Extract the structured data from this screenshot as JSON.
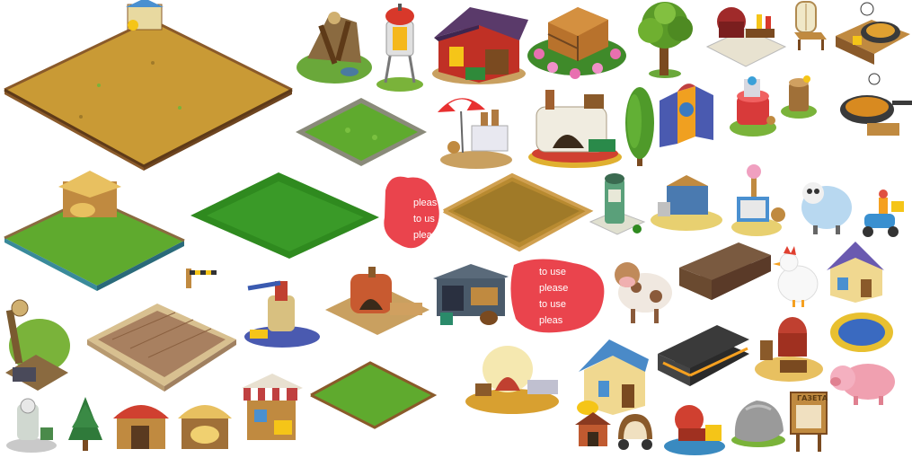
{
  "sheet": {
    "watermark_a": {
      "line1": "pleas",
      "line2": "to us",
      "line3": "pleas"
    },
    "watermark_b": {
      "line1": "to use",
      "line2": "please",
      "line3": "to use",
      "line4": "pleas"
    },
    "notice_board_text": "ГАЗЕТА"
  },
  "colors": {
    "soil": "#c99a35",
    "grass": "#5faa2e",
    "dark_grass": "#2f8a1f",
    "fence": "#8a5a2a",
    "watermark_red": "#e8303a"
  },
  "assets": [
    "plowed-field-fenced-large",
    "mine-shaft-ruins",
    "water-tower",
    "barn-red-purple-roof",
    "wooden-crate-flowers",
    "oak-tree",
    "bbq-grill",
    "wooden-chair",
    "cooking-stove-chef",
    "grass-plot-stone-border",
    "market-umbrella-stall",
    "stone-oven",
    "cypress-tree",
    "folding-screen",
    "red-decoration-tower",
    "tree-stump",
    "frying-pan-stall",
    "chicken-coop-straw-roof",
    "grass-field-fenced",
    "grass-tile",
    "dirt-pen-fence",
    "fuel-pump",
    "loom-workshop",
    "ice-cream-cart",
    "sheep",
    "scooter-rider",
    "stone-well-plot",
    "hand-pump",
    "brick-bakery",
    "blacksmith-forge",
    "cow",
    "train-wagon",
    "chicken",
    "cottage-purple-roof",
    "pond",
    "mine-cart",
    "raised-bed",
    "bread-oven-dome",
    "blue-roof-house",
    "locomotive",
    "distillery",
    "pig",
    "boulder",
    "notice-board",
    "small-dog-house",
    "hay-barn",
    "pine-tree",
    "tool-shed",
    "market-stall-striped",
    "grass-plot-fenced",
    "bamboo-stand",
    "cage-cart",
    "steam-engine-machine"
  ]
}
